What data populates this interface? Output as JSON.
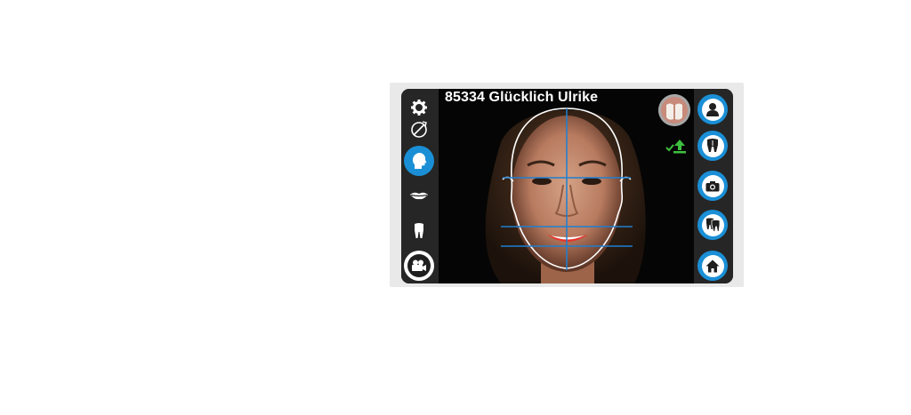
{
  "patient": {
    "name_label": "85334 Glücklich Ulrike"
  },
  "left_toolbar": {
    "items": [
      {
        "id": "settings",
        "icon": "gear-icon",
        "active": false
      },
      {
        "id": "rotate",
        "icon": "rotate-icon",
        "active": false
      },
      {
        "id": "face",
        "icon": "head-profile-icon",
        "active": true
      },
      {
        "id": "lips",
        "icon": "lips-icon",
        "active": false
      },
      {
        "id": "tooth",
        "icon": "tooth-icon",
        "active": false
      },
      {
        "id": "video",
        "icon": "video-camera-icon",
        "active": false
      }
    ]
  },
  "right_toolbar": {
    "items": [
      {
        "id": "patient",
        "icon": "user-icon"
      },
      {
        "id": "teeth",
        "icon": "tooth-icon"
      },
      {
        "id": "camera",
        "icon": "camera-icon"
      },
      {
        "id": "teeth-library",
        "icon": "teeth-stack-icon"
      },
      {
        "id": "home",
        "icon": "home-icon"
      }
    ]
  },
  "overlay": {
    "thumbnail": "teeth-preview",
    "upload_icon": "upload-check-icon",
    "colors": {
      "accent": "#1a8fd6",
      "guide_lines": "#1e7fd0",
      "face_outline": "#ffffff",
      "upload_green": "#3fbf3f"
    }
  }
}
